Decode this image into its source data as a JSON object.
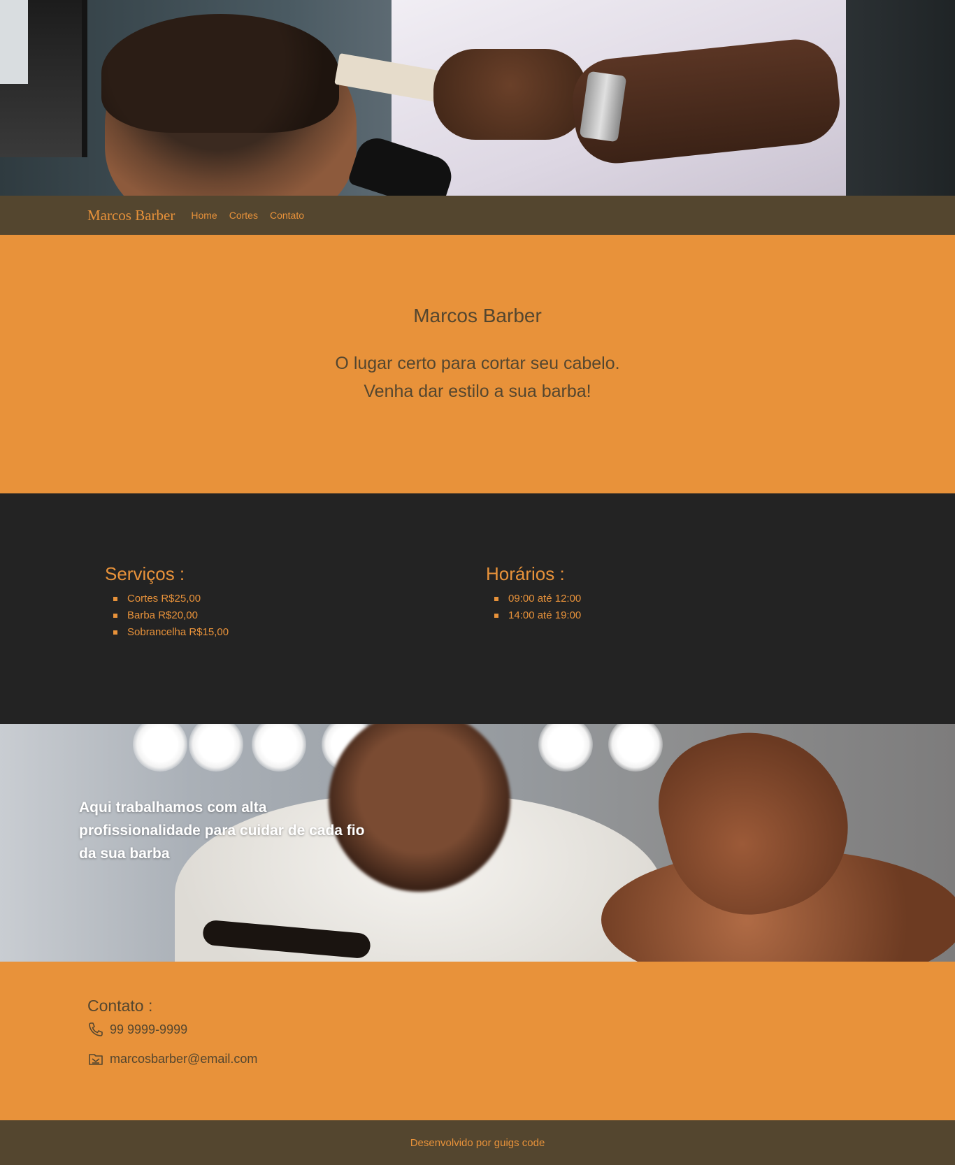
{
  "navbar": {
    "brand": "Marcos Barber",
    "links": [
      "Home",
      "Cortes",
      "Contato"
    ]
  },
  "intro": {
    "title": "Marcos Barber",
    "line1": "O lugar certo para cortar seu cabelo.",
    "line2": "Venha dar estilo a sua barba!"
  },
  "services": {
    "heading": "Serviços :",
    "items": [
      "Cortes R$25,00",
      "Barba R$20,00",
      "Sobrancelha R$15,00"
    ]
  },
  "hours": {
    "heading": "Horários :",
    "items": [
      "09:00 até 12:00",
      "14:00 até 19:00"
    ]
  },
  "banner": {
    "text": "Aqui trabalhamos com alta profissionalidade para cuidar de cada fio da sua barba"
  },
  "contact": {
    "heading": "Contato :",
    "phone": "99 9999-9999",
    "phone_icon": "phone-icon",
    "email": "marcosbarber@email.com",
    "email_icon": "mail-icon"
  },
  "footer": {
    "text": "Desenvolvido por guigs code"
  },
  "colors": {
    "accent": "#e8923a",
    "brown": "#54462f",
    "dark": "#232323"
  }
}
